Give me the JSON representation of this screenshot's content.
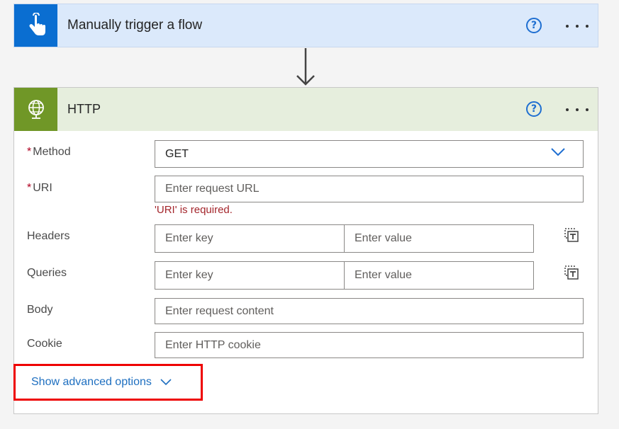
{
  "trigger": {
    "title": "Manually trigger a flow",
    "icon": "touch-hand-icon",
    "accent": "#0a6ed1",
    "help_glyph": "?"
  },
  "http_action": {
    "title": "HTTP",
    "icon": "globe-icon",
    "accent": "#709727",
    "help_glyph": "?",
    "fields": {
      "method": {
        "label": "Method",
        "required_mark": "*",
        "value": "GET"
      },
      "uri": {
        "label": "URI",
        "required_mark": "*",
        "placeholder": "Enter request URL",
        "error": "'URI' is required."
      },
      "headers": {
        "label": "Headers",
        "key_placeholder": "Enter key",
        "value_placeholder": "Enter value"
      },
      "queries": {
        "label": "Queries",
        "key_placeholder": "Enter key",
        "value_placeholder": "Enter value"
      },
      "body": {
        "label": "Body",
        "placeholder": "Enter request content"
      },
      "cookie": {
        "label": "Cookie",
        "placeholder": "Enter HTTP cookie"
      }
    },
    "advanced": {
      "label": "Show advanced options",
      "highlight_color": "#ee0000"
    }
  }
}
